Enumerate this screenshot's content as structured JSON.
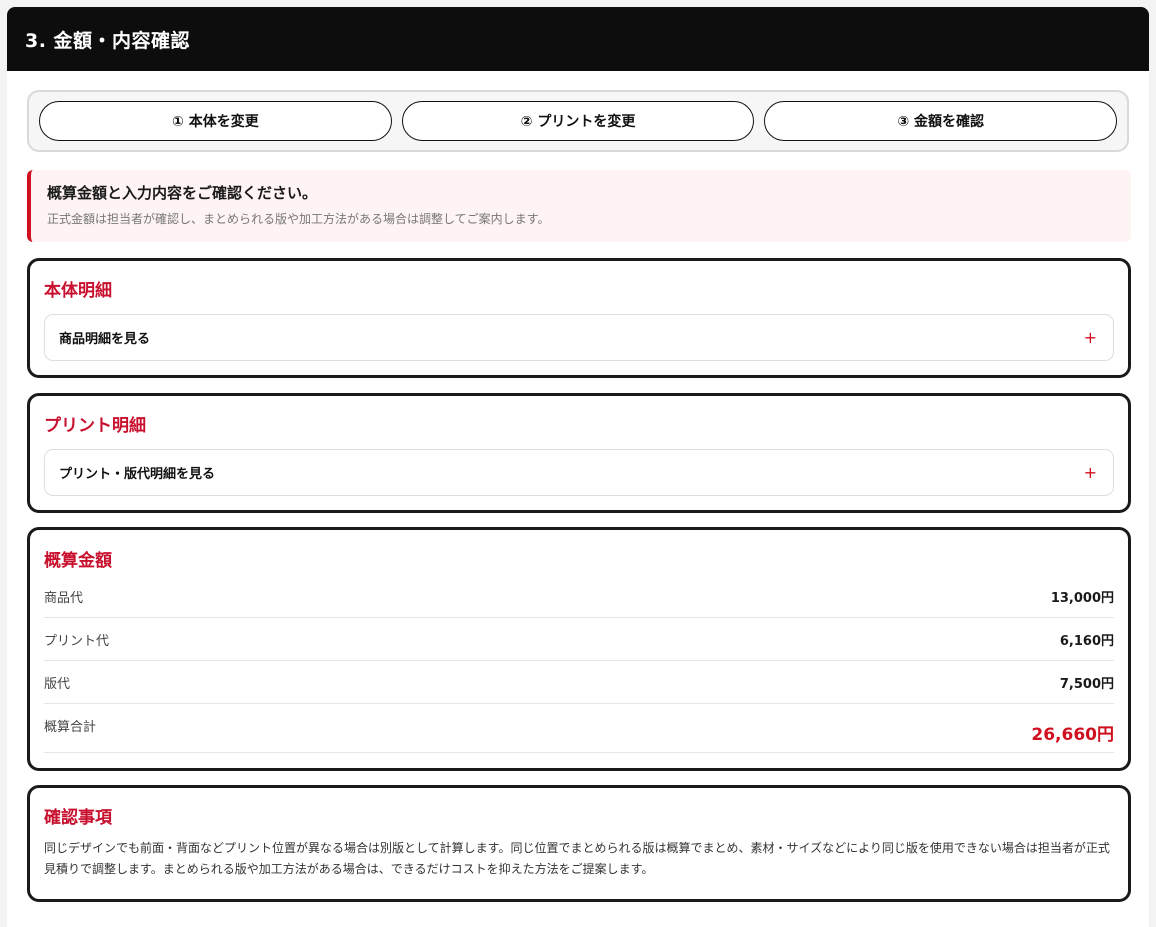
{
  "header": {
    "title": "3. 金額・内容確認"
  },
  "steps": [
    {
      "label": "① 本体を変更"
    },
    {
      "label": "② プリントを変更"
    },
    {
      "label": "③ 金額を確認"
    }
  ],
  "notice": {
    "title": "概算金額と入力内容をご確認ください。",
    "text": "正式金額は担当者が確認し、まとめられる版や加工方法がある場合は調整してご案内します。"
  },
  "body_detail": {
    "title": "本体明細",
    "accordion_label": "商品明細を見る",
    "toggle": "+"
  },
  "print_detail": {
    "title": "プリント明細",
    "accordion_label": "プリント・版代明細を見る",
    "toggle": "+"
  },
  "estimate": {
    "title": "概算金額",
    "rows": [
      {
        "label": "商品代",
        "value": "13,000円"
      },
      {
        "label": "プリント代",
        "value": "6,160円"
      },
      {
        "label": "版代",
        "value": "7,500円"
      }
    ],
    "total": {
      "label": "概算合計",
      "value": "26,660円"
    }
  },
  "confirm": {
    "title": "確認事項",
    "text": "同じデザインでも前面・背面などプリント位置が異なる場合は別版として計算します。同じ位置でまとめられる版は概算でまとめ、素材・サイズなどにより同じ版を使用できない場合は担当者が正式見積りで調整します。まとめられる版や加工方法がある場合は、できるだけコストを抑えた方法をご提案します。"
  },
  "colors": {
    "accent": "#c8102e",
    "header_bg": "#0d0d0d",
    "notice_bg": "#fff4f4"
  }
}
